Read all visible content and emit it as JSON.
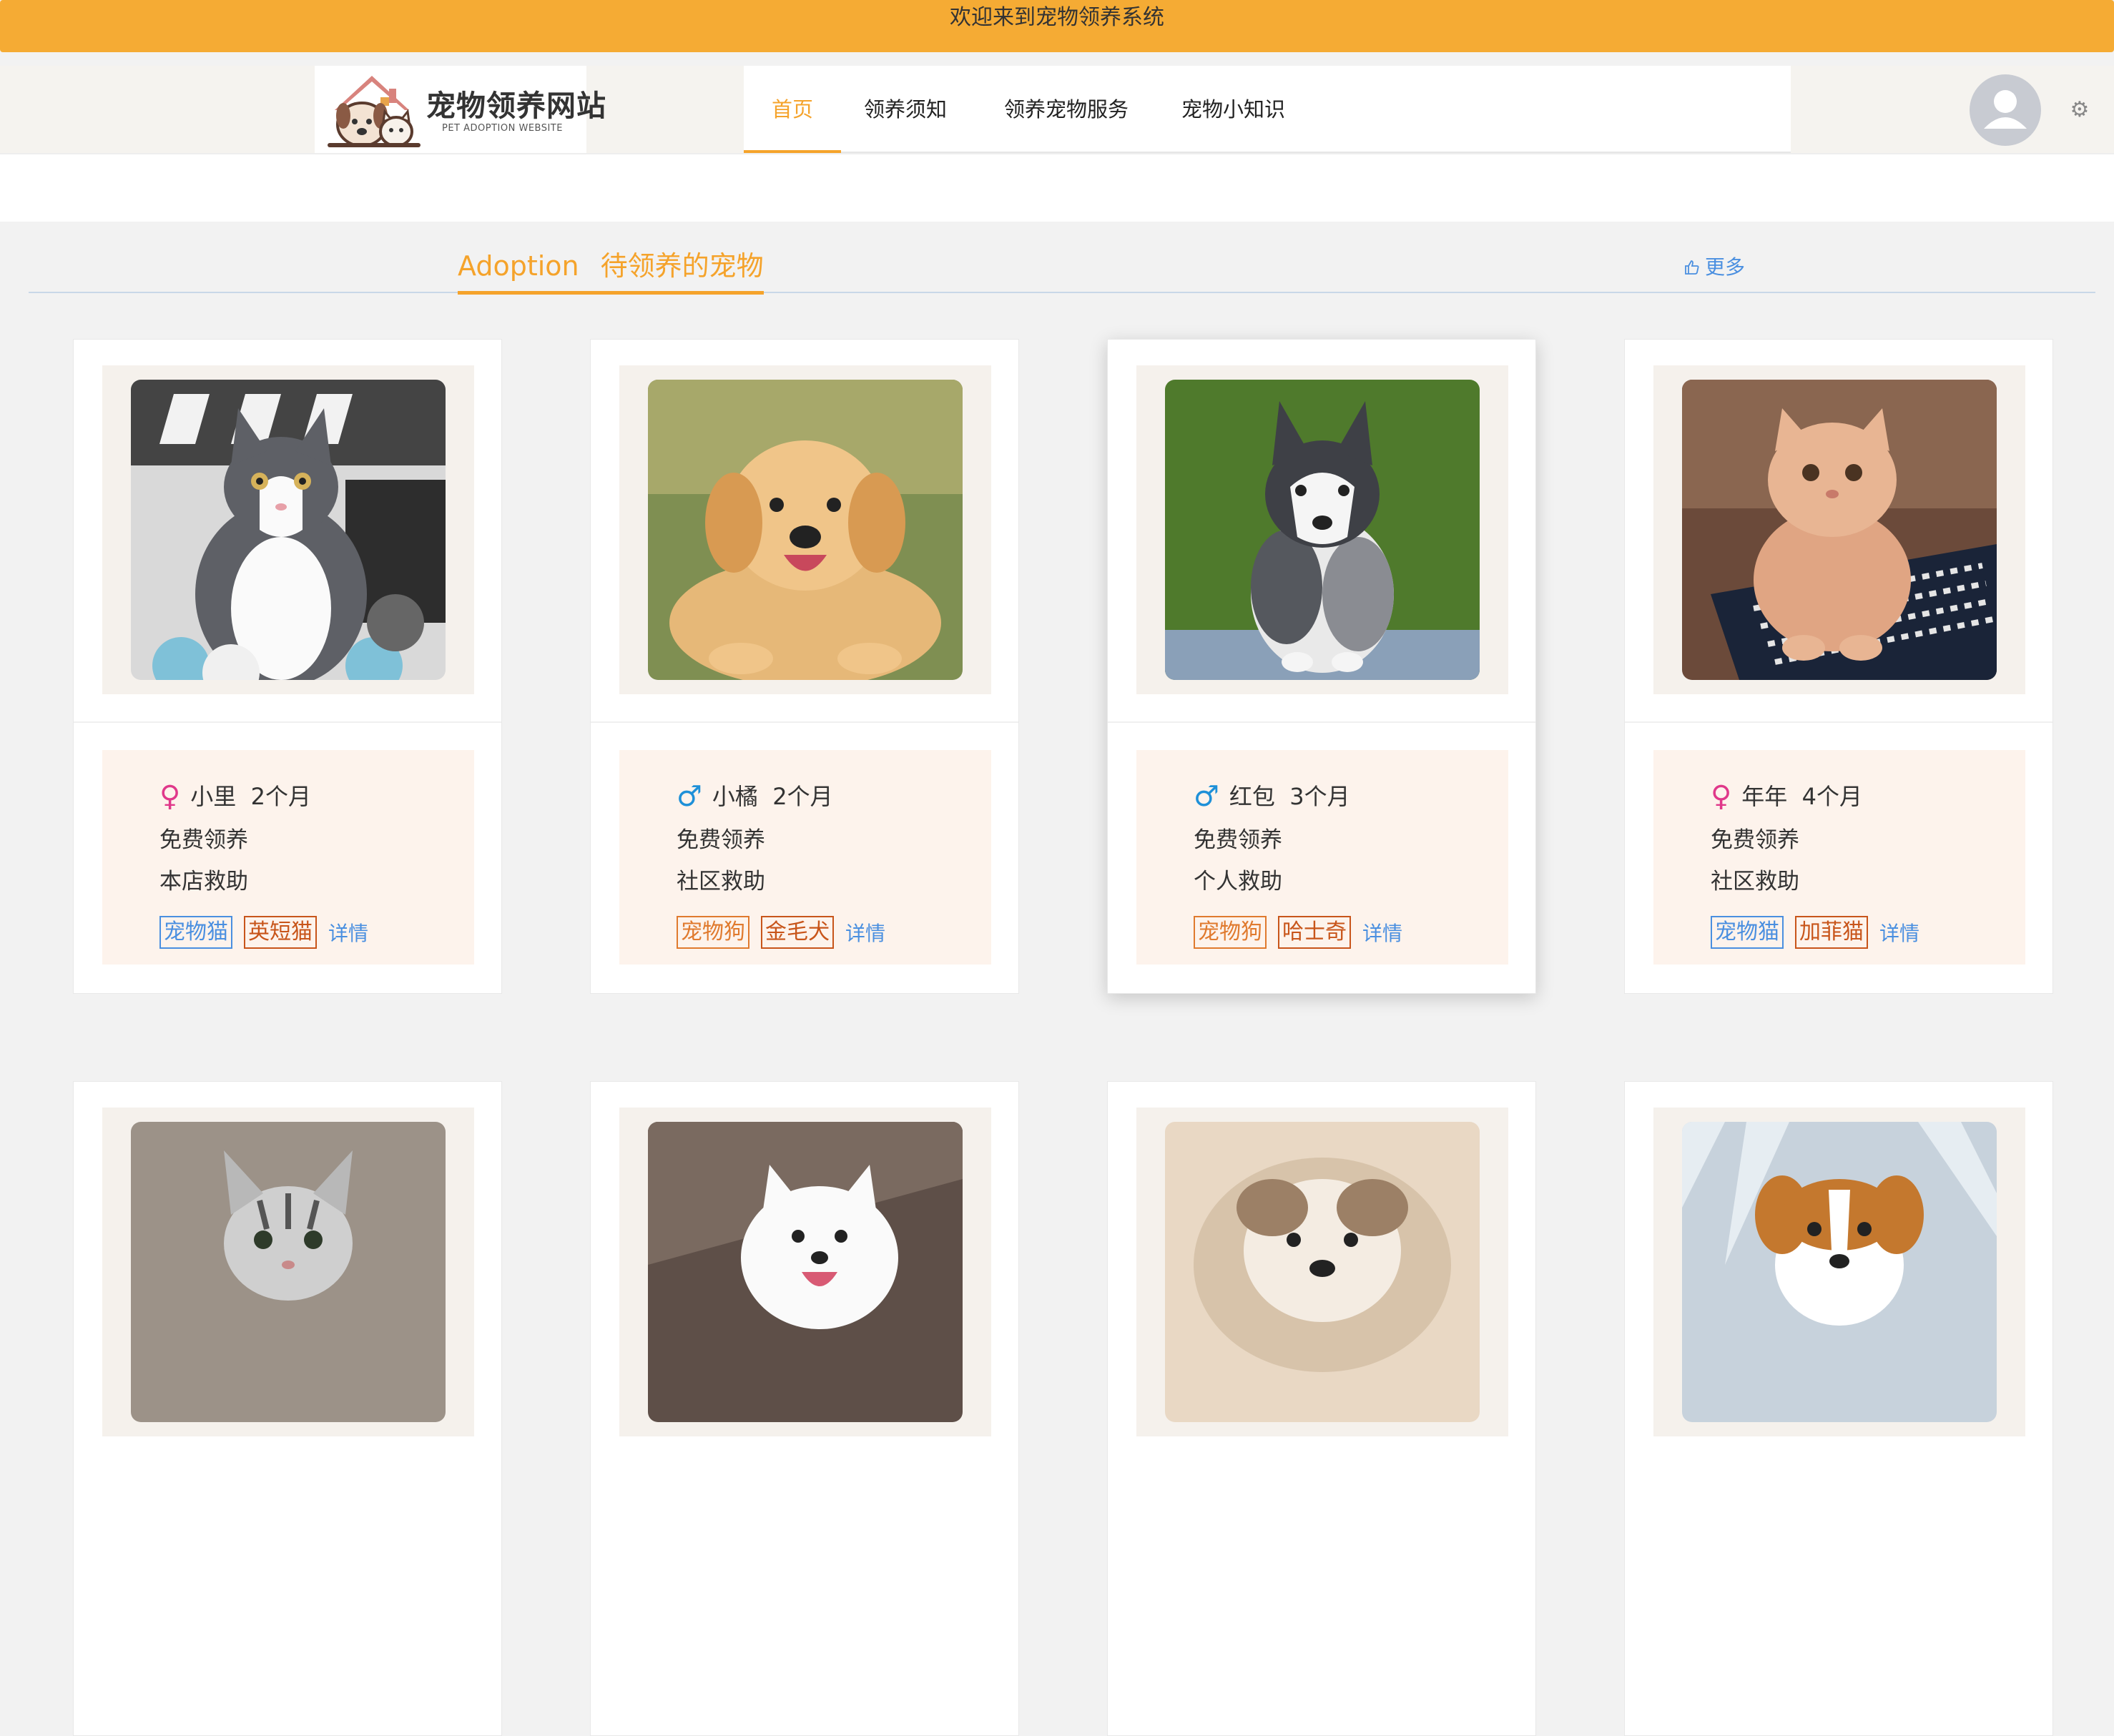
{
  "banner": {
    "text": "欢迎来到宠物领养系统"
  },
  "logo": {
    "title": "宠物领养网站",
    "subtitle": "PET ADOPTION WEBSITE"
  },
  "nav": {
    "items": [
      {
        "label": "首页",
        "active": true
      },
      {
        "label": "领养须知",
        "active": false
      },
      {
        "label": "领养宠物服务",
        "active": false
      },
      {
        "label": "宠物小知识",
        "active": false
      }
    ]
  },
  "section": {
    "title_en": "Adoption",
    "title_cn": "待领养的宠物",
    "more_label": "更多"
  },
  "pets": [
    {
      "gender": "female",
      "gender_symbol": "♀",
      "name": "小里",
      "age": "2个月",
      "fee": "免费领养",
      "source": "本店救助",
      "type_tag": "宠物猫",
      "breed_tag": "英短猫",
      "detail_label": "详情",
      "photo_icon": "cat-photo"
    },
    {
      "gender": "male",
      "gender_symbol": "♂",
      "name": "小橘",
      "age": "2个月",
      "fee": "免费领养",
      "source": "社区救助",
      "type_tag": "宠物狗",
      "breed_tag": "金毛犬",
      "detail_label": "详情",
      "photo_icon": "dog-photo"
    },
    {
      "gender": "male",
      "gender_symbol": "♂",
      "name": "红包",
      "age": "3个月",
      "fee": "免费领养",
      "source": "个人救助",
      "type_tag": "宠物狗",
      "breed_tag": "哈士奇",
      "detail_label": "详情",
      "photo_icon": "dog-photo"
    },
    {
      "gender": "female",
      "gender_symbol": "♀",
      "name": "年年",
      "age": "4个月",
      "fee": "免费领养",
      "source": "社区救助",
      "type_tag": "宠物猫",
      "breed_tag": "加菲猫",
      "detail_label": "详情",
      "photo_icon": "cat-photo"
    }
  ],
  "colors": {
    "accent": "#f5a32b",
    "banner": "#f5ab34",
    "link": "#4a8fe0",
    "info_bg": "#fdf3ec"
  }
}
